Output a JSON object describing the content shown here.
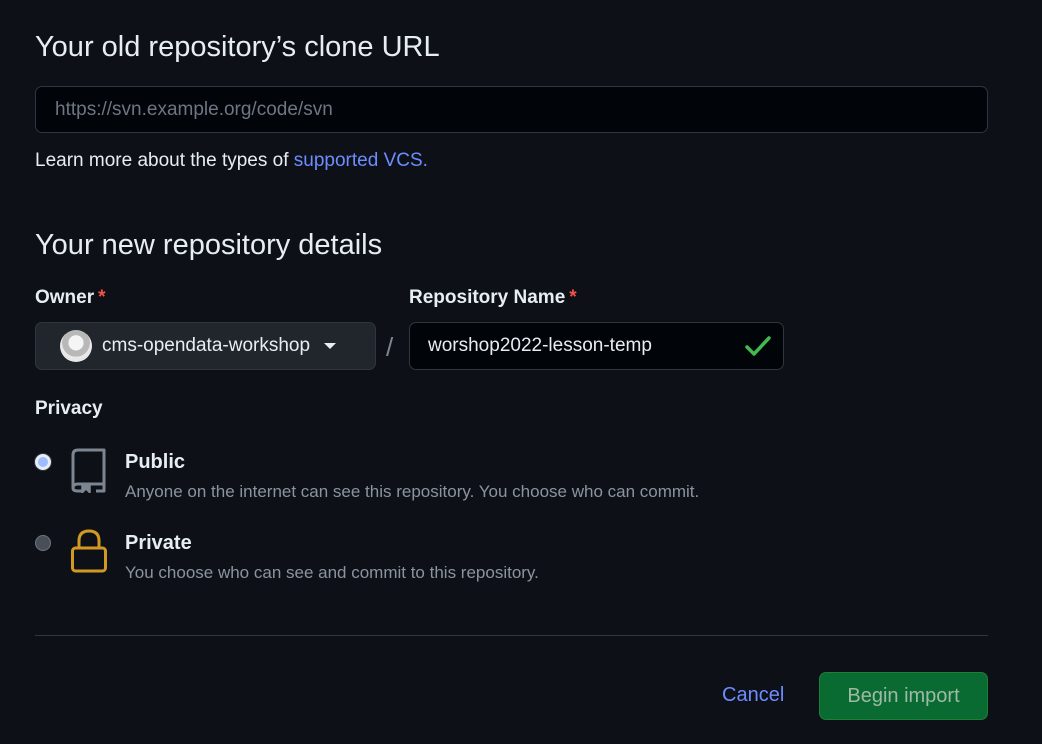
{
  "clone": {
    "heading": "Your old repository’s clone URL",
    "url_placeholder": "https://svn.example.org/code/svn",
    "url_value": "",
    "learn_prefix": "Learn more about the types of ",
    "learn_link": "supported VCS."
  },
  "details": {
    "heading": "Your new repository details",
    "owner_label": "Owner",
    "repo_label": "Repository Name",
    "required_mark": "*",
    "owner_value": "cms-opendata-workshop",
    "separator": "/",
    "repo_value": "worshop2022-lesson-temp"
  },
  "privacy": {
    "label": "Privacy",
    "options": [
      {
        "title": "Public",
        "description": "Anyone on the internet can see this repository. You choose who can commit.",
        "icon": "repo-icon",
        "selected": true
      },
      {
        "title": "Private",
        "description": "You choose who can see and commit to this repository.",
        "icon": "lock-icon",
        "selected": false
      }
    ]
  },
  "actions": {
    "cancel": "Cancel",
    "begin": "Begin import"
  },
  "colors": {
    "background": "#0d1117",
    "link": "#6d8cff",
    "required": "#f85149",
    "success": "#3fb950",
    "lock": "#d29922",
    "primary_button": "#0a6b32"
  }
}
